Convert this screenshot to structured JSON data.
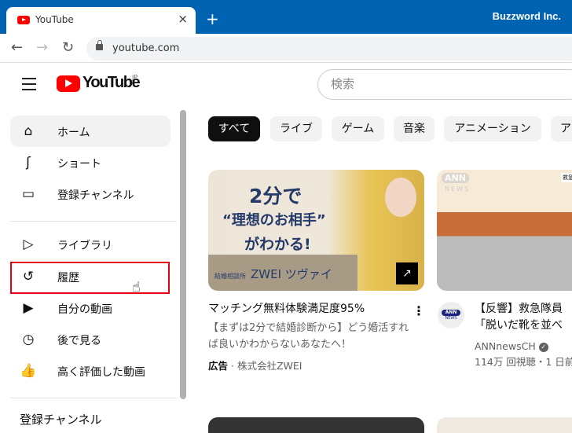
{
  "browser": {
    "tab_title": "YouTube",
    "new_tab": "+",
    "close": "×",
    "profile": "Buzzword Inc.",
    "url": "youtube.com",
    "back": "←",
    "forward": "→",
    "reload": "↻"
  },
  "header": {
    "logo": "YouTube",
    "region": "JP",
    "search_placeholder": "検索"
  },
  "sidebar": {
    "items": [
      {
        "label": "ホーム",
        "icon": "home-icon",
        "glyph": "⌂"
      },
      {
        "label": "ショート",
        "icon": "shorts-icon",
        "glyph": "ʃ"
      },
      {
        "label": "登録チャンネル",
        "icon": "subscriptions-icon",
        "glyph": "▭"
      },
      {
        "label": "ライブラリ",
        "icon": "library-icon",
        "glyph": "▷"
      },
      {
        "label": "履歴",
        "icon": "history-icon",
        "glyph": "↺"
      },
      {
        "label": "自分の動画",
        "icon": "your-videos-icon",
        "glyph": "▶"
      },
      {
        "label": "後で見る",
        "icon": "watch-later-icon",
        "glyph": "◷"
      },
      {
        "label": "高く評価した動画",
        "icon": "liked-icon",
        "glyph": "👍"
      }
    ],
    "section": "登録チャンネル",
    "highlight_color": "#e60012"
  },
  "chips": [
    "すべて",
    "ライブ",
    "ゲーム",
    "音楽",
    "アニメーション",
    "ア"
  ],
  "videos": [
    {
      "title": "マッチング無料体験満足度95%",
      "desc1": "【まずは2分で結婚診断から】どう婚活すれ",
      "desc2": "ば良いかわからないあなたへ！",
      "ad_label": "広告",
      "advertiser": "株式会社ZWEI",
      "thumb": {
        "l1": "2分で",
        "l2": "“理想のお相手”",
        "l3": "がわかる!",
        "small": "結婚相談所",
        "brand": "ZWEI ツヴァイ"
      }
    },
    {
      "title1": "【反響】救急隊員",
      "title2": "「脱いだ靴を並べ",
      "channel": "ANNnewsCH",
      "views": "114万 回視聴・1 日前",
      "avatar": "ANN",
      "avatar_sub": "NEWS",
      "thumb": {
        "ann": "ANN",
        "news": "NEWS",
        "tag": "救急隊員"
      }
    }
  ],
  "colors": {
    "browser_blue": "#0063b1",
    "youtube_red": "#ff0000"
  }
}
